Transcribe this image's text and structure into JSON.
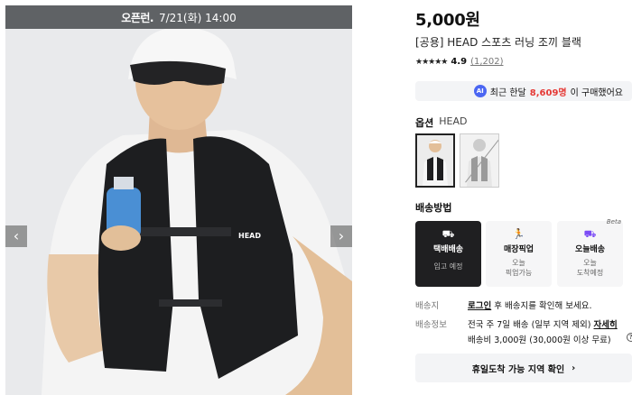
{
  "banner": {
    "brand": "오픈런.",
    "date": "7/21(화) 14:00"
  },
  "gallery": {
    "prev": "‹",
    "next": "›",
    "vest_logo": "HEAD"
  },
  "product": {
    "price": "5,000원",
    "title": "[공용] HEAD 스포츠 러닝 조끼 블랙",
    "stars": "★★★★★",
    "rating": "4.9",
    "review_count": "(1,202)"
  },
  "buyers": {
    "badge": "AI",
    "prefix": "최근 한달",
    "count": "8,609명",
    "suffix": "이 구매했어요"
  },
  "option": {
    "label": "옵션",
    "value": "HEAD"
  },
  "shipping": {
    "title": "배송방법",
    "methods": [
      {
        "name": "택배배송",
        "sub": "입고 예정",
        "icon": "truck-icon"
      },
      {
        "name": "매장픽업",
        "sub": "오늘\n픽업가능",
        "icon": "runner-icon"
      },
      {
        "name": "오늘배송",
        "sub": "오늘\n도착예정",
        "icon": "fast-truck-icon",
        "tag": "Beta"
      }
    ]
  },
  "delivery": {
    "addr_label": "배송지",
    "login": "로그인",
    "addr_text": "후 배송지를 확인해 보세요.",
    "info_label": "배송정보",
    "info_text": "전국 주 7일 배송 (일부 지역 제외)",
    "details": "자세히",
    "fee": "배송비 3,000원 (30,000원 이상 무료)"
  },
  "holiday_button": "휴일도착 가능 지역 확인",
  "colors": {
    "accent_red": "#e53935",
    "ai_blue": "#4b66f2",
    "selected_card": "#1f1f21"
  }
}
